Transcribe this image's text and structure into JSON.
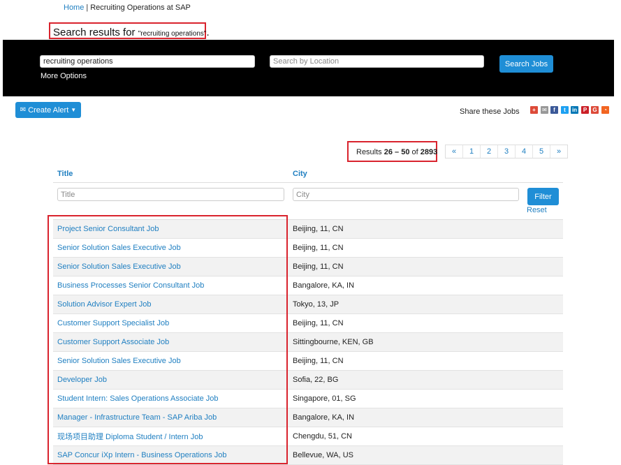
{
  "breadcrumb": {
    "home": "Home",
    "separator": "|",
    "current": "Recruiting Operations at SAP"
  },
  "search_heading": {
    "prefix": "Search results for ",
    "query": "\"recruiting operations\"",
    "suffix": "."
  },
  "search": {
    "keyword_value": "recruiting operations",
    "location_placeholder": "Search by Location",
    "more_options": "More Options",
    "button": "Search Jobs"
  },
  "create_alert": {
    "icon": "envelope-icon",
    "label": "Create Alert"
  },
  "share": {
    "label": "Share these Jobs",
    "icons": [
      {
        "name": "google-plus-icon",
        "glyph": "+",
        "color": "#dd4b39"
      },
      {
        "name": "email-icon",
        "glyph": "✉",
        "color": "#999999"
      },
      {
        "name": "facebook-icon",
        "glyph": "f",
        "color": "#3b5998"
      },
      {
        "name": "twitter-icon",
        "glyph": "t",
        "color": "#1da1f2"
      },
      {
        "name": "linkedin-icon",
        "glyph": "in",
        "color": "#0077b5"
      },
      {
        "name": "pinterest-icon",
        "glyph": "P",
        "color": "#cb2027"
      },
      {
        "name": "google-icon",
        "glyph": "G",
        "color": "#dd4b39"
      },
      {
        "name": "rss-icon",
        "glyph": "◔",
        "color": "#f26522"
      }
    ]
  },
  "results": {
    "prefix": "Results ",
    "range": "26 – 50",
    "of": " of ",
    "total": "2893"
  },
  "pagination": [
    "«",
    "1",
    "2",
    "3",
    "4",
    "5",
    "»"
  ],
  "table": {
    "headers": {
      "title": "Title",
      "city": "City"
    },
    "filters": {
      "title_placeholder": "Title",
      "city_placeholder": "City",
      "button": "Filter",
      "reset": "Reset"
    },
    "rows": [
      {
        "title": "Project Senior Consultant Job",
        "city": "Beijing, 11, CN"
      },
      {
        "title": "Senior Solution Sales Executive Job",
        "city": "Beijing, 11, CN"
      },
      {
        "title": "Senior Solution Sales Executive Job",
        "city": "Beijing, 11, CN"
      },
      {
        "title": "Business Processes Senior Consultant Job",
        "city": "Bangalore, KA, IN"
      },
      {
        "title": "Solution Advisor Expert Job",
        "city": "Tokyo, 13, JP"
      },
      {
        "title": "Customer Support Specialist Job",
        "city": "Beijing, 11, CN"
      },
      {
        "title": "Customer Support Associate Job",
        "city": "Sittingbourne, KEN, GB"
      },
      {
        "title": "Senior Solution Sales Executive Job",
        "city": "Beijing, 11, CN"
      },
      {
        "title": "Developer Job",
        "city": "Sofia, 22, BG"
      },
      {
        "title": "Student Intern: Sales Operations Associate Job",
        "city": "Singapore, 01, SG"
      },
      {
        "title": "Manager - Infrastructure Team - SAP Ariba Job",
        "city": "Bangalore, KA, IN"
      },
      {
        "title": "现场项目助理 Diploma Student / Intern Job",
        "city": "Chengdu, 51, CN"
      },
      {
        "title": "SAP Concur iXp Intern - Business Operations Job",
        "city": "Bellevue, WA, US"
      }
    ]
  },
  "colors": {
    "link": "#1f7fc1",
    "button": "#1f8ed6",
    "highlight": "#d9232d",
    "search_band": "#000000"
  }
}
